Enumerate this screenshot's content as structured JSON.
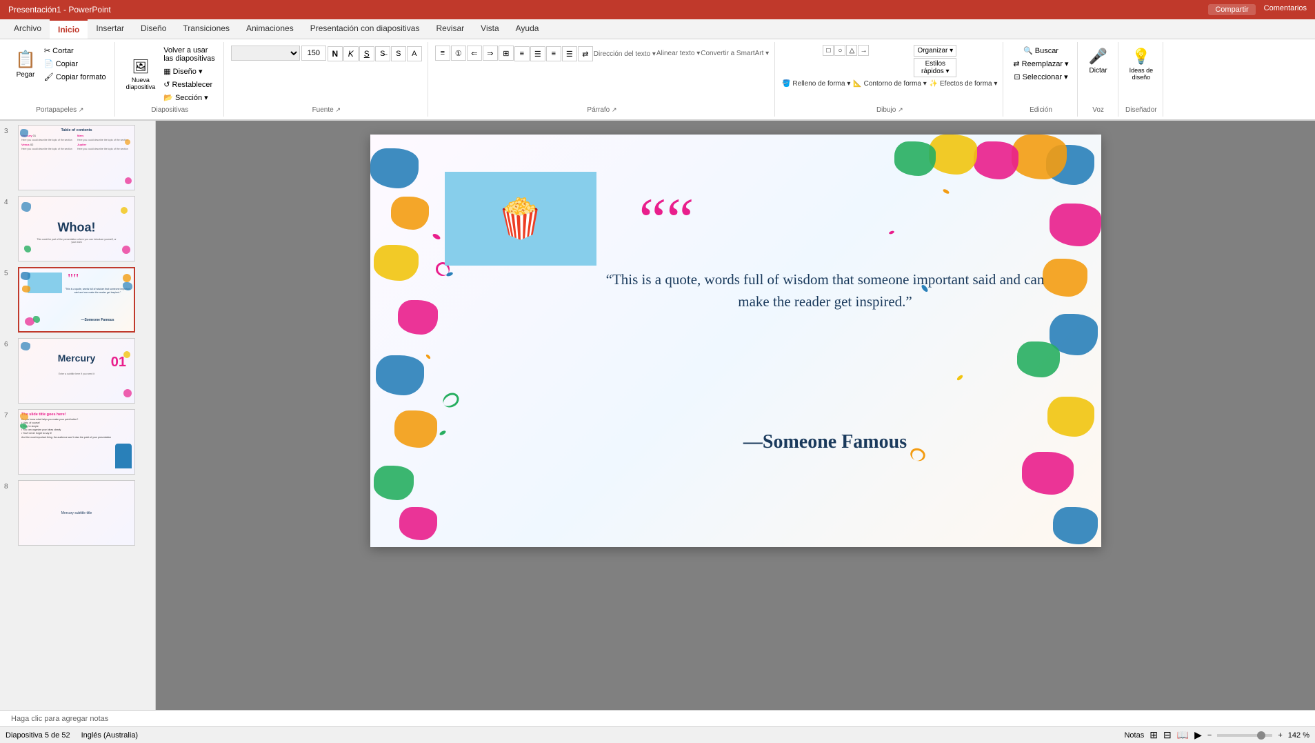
{
  "app": {
    "title": "Presentación1 - PowerPoint",
    "share_label": "Compartir",
    "comments_label": "Comentarios"
  },
  "ribbon": {
    "tabs": [
      {
        "id": "archivo",
        "label": "Archivo"
      },
      {
        "id": "inicio",
        "label": "Inicio",
        "active": true
      },
      {
        "id": "insertar",
        "label": "Insertar"
      },
      {
        "id": "diseno",
        "label": "Diseño"
      },
      {
        "id": "transiciones",
        "label": "Transiciones"
      },
      {
        "id": "animaciones",
        "label": "Animaciones"
      },
      {
        "id": "presentacion",
        "label": "Presentación con diapositivas"
      },
      {
        "id": "revisar",
        "label": "Revisar"
      },
      {
        "id": "vista",
        "label": "Vista"
      },
      {
        "id": "ayuda",
        "label": "Ayuda"
      }
    ],
    "groups": {
      "portapapeles": {
        "label": "Portapapeles",
        "buttons": [
          "Pegar",
          "Cortar",
          "Copiar",
          "Copiar formato"
        ]
      },
      "diapositivas": {
        "label": "Diapositivas",
        "buttons": [
          "Nueva diapositiva",
          "Volver a usar las diapositivas",
          "Diseño",
          "Restablecer",
          "Sección"
        ]
      },
      "fuente": {
        "label": "Fuente"
      },
      "parrafo": {
        "label": "Párrafo"
      },
      "dibujo": {
        "label": "Dibujo"
      },
      "edicion": {
        "label": "Edición",
        "buttons": [
          "Buscar",
          "Reemplazar",
          "Seleccionar"
        ]
      },
      "voz": {
        "label": "Voz",
        "buttons": [
          "Dictar"
        ]
      },
      "disenador": {
        "label": "Diseñador",
        "buttons": [
          "Ideas de diseño"
        ]
      }
    }
  },
  "slides": [
    {
      "num": 3,
      "type": "toc"
    },
    {
      "num": 4,
      "type": "whoa"
    },
    {
      "num": 5,
      "type": "quote",
      "active": true
    },
    {
      "num": 6,
      "type": "mercury"
    },
    {
      "num": 7,
      "type": "title_slide"
    },
    {
      "num": 8,
      "type": "next"
    }
  ],
  "current_slide": {
    "num": 5,
    "quote_text": "“This is a quote, words full of wisdom that someone important said and can make the reader get inspired.”",
    "author": "—Someone Famous",
    "quote_mark": "““"
  },
  "notes_placeholder": "Haga clic para agregar notas",
  "status": {
    "slide_info": "Diapositiva 5 de 52",
    "language": "Inglés (Australia)",
    "zoom": "142 %",
    "notes_label": "Notas"
  },
  "colors": {
    "accent_red": "#c0392b",
    "quote_pink": "#e91e8c",
    "dark_blue": "#1a3a5c",
    "orange": "#f39c12",
    "green": "#27ae60",
    "teal": "#1abc9c",
    "blue": "#2980b9",
    "yellow": "#f1c40f",
    "magenta": "#e91e8c"
  }
}
